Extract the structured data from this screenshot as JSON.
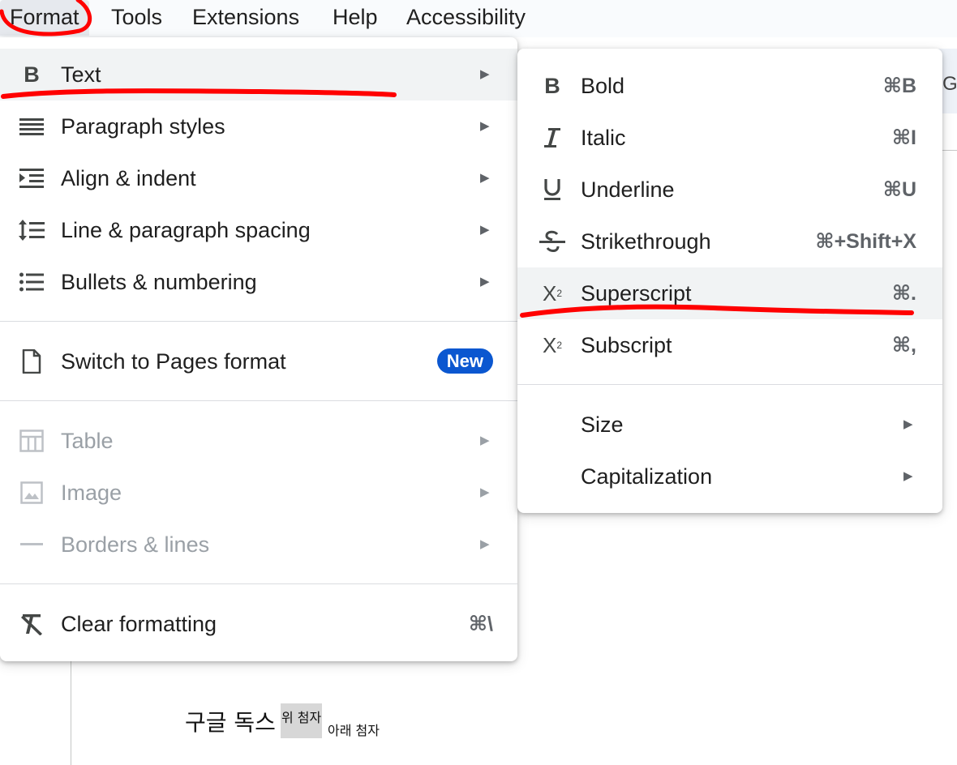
{
  "menubar": {
    "items": [
      "Format",
      "Tools",
      "Extensions",
      "Help",
      "Accessibility"
    ],
    "active": "Format"
  },
  "toolbar_letter": "G",
  "format_menu": {
    "items": [
      {
        "label": "Text",
        "icon": "bold-icon",
        "submenu": true,
        "highlighted": true
      },
      {
        "label": "Paragraph styles",
        "icon": "paragraph-styles-icon",
        "submenu": true
      },
      {
        "label": "Align & indent",
        "icon": "align-indent-icon",
        "submenu": true
      },
      {
        "label": "Line & paragraph spacing",
        "icon": "line-spacing-icon",
        "submenu": true
      },
      {
        "label": "Bullets & numbering",
        "icon": "bulleted-list-icon",
        "submenu": true
      },
      {
        "label": "Switch to Pages format",
        "icon": "page-icon",
        "badge": "New"
      },
      {
        "label": "Table",
        "icon": "table-icon",
        "submenu": true,
        "disabled": true
      },
      {
        "label": "Image",
        "icon": "image-icon",
        "submenu": true,
        "disabled": true
      },
      {
        "label": "Borders & lines",
        "icon": "border-line-icon",
        "submenu": true,
        "disabled": true
      },
      {
        "label": "Clear formatting",
        "icon": "clear-formatting-icon",
        "shortcut": "⌘\\"
      }
    ]
  },
  "text_submenu": {
    "items": [
      {
        "label": "Bold",
        "icon": "bold-icon",
        "shortcut": "⌘B"
      },
      {
        "label": "Italic",
        "icon": "italic-icon",
        "shortcut": "⌘I"
      },
      {
        "label": "Underline",
        "icon": "underline-icon",
        "shortcut": "⌘U"
      },
      {
        "label": "Strikethrough",
        "icon": "strikethrough-icon",
        "shortcut": "⌘+Shift+X"
      },
      {
        "label": "Superscript",
        "icon": "superscript-icon",
        "shortcut": "⌘.",
        "highlighted": true
      },
      {
        "label": "Subscript",
        "icon": "subscript-icon",
        "shortcut": "⌘,"
      },
      {
        "label": "Size",
        "submenu": true
      },
      {
        "label": "Capitalization",
        "submenu": true
      }
    ]
  },
  "document": {
    "text": "구글 독스",
    "superscript": "위 첨자",
    "subscript": "아래 첨자"
  },
  "colors": {
    "annotation": "#ff0000",
    "badge": "#0b57d0",
    "highlight": "#f1f3f4"
  }
}
